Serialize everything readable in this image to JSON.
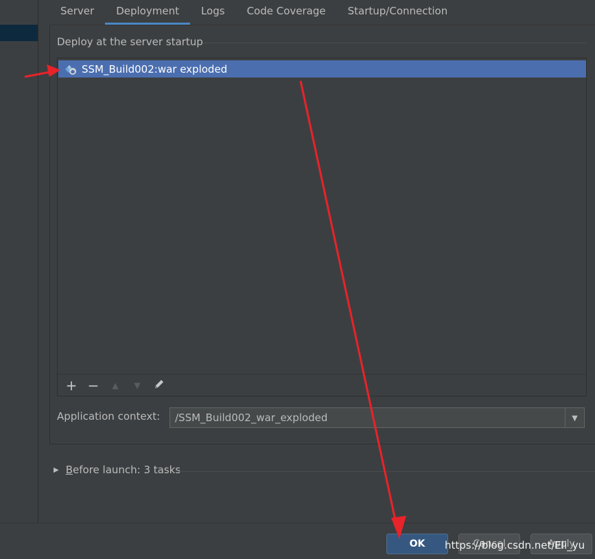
{
  "tabs": [
    {
      "label": "Server",
      "active": false
    },
    {
      "label": "Deployment",
      "active": true
    },
    {
      "label": "Logs",
      "active": false
    },
    {
      "label": "Code Coverage",
      "active": false
    },
    {
      "label": "Startup/Connection",
      "active": false
    }
  ],
  "deploy": {
    "section_title": "Deploy at the server startup",
    "items": [
      {
        "label": "SSM_Build002:war exploded",
        "icon": "artifact-icon",
        "selected": true
      }
    ],
    "toolbar": {
      "add": "+",
      "remove": "−",
      "up": "▲",
      "down": "▼",
      "edit": "pencil-icon"
    }
  },
  "context": {
    "label": "Application context:",
    "value": "/SSM_Build002_war_exploded"
  },
  "before_launch": {
    "label": "Before launch: 3 tasks"
  },
  "buttons": {
    "ok": "OK",
    "cancel": "Cancel",
    "apply": "Apply"
  },
  "watermark": "https://blog.csdn.net/Eli_yu",
  "colors": {
    "selection": "#4b6eaf",
    "active_tab": "#4a88c7",
    "annotation": "#e8232a"
  }
}
